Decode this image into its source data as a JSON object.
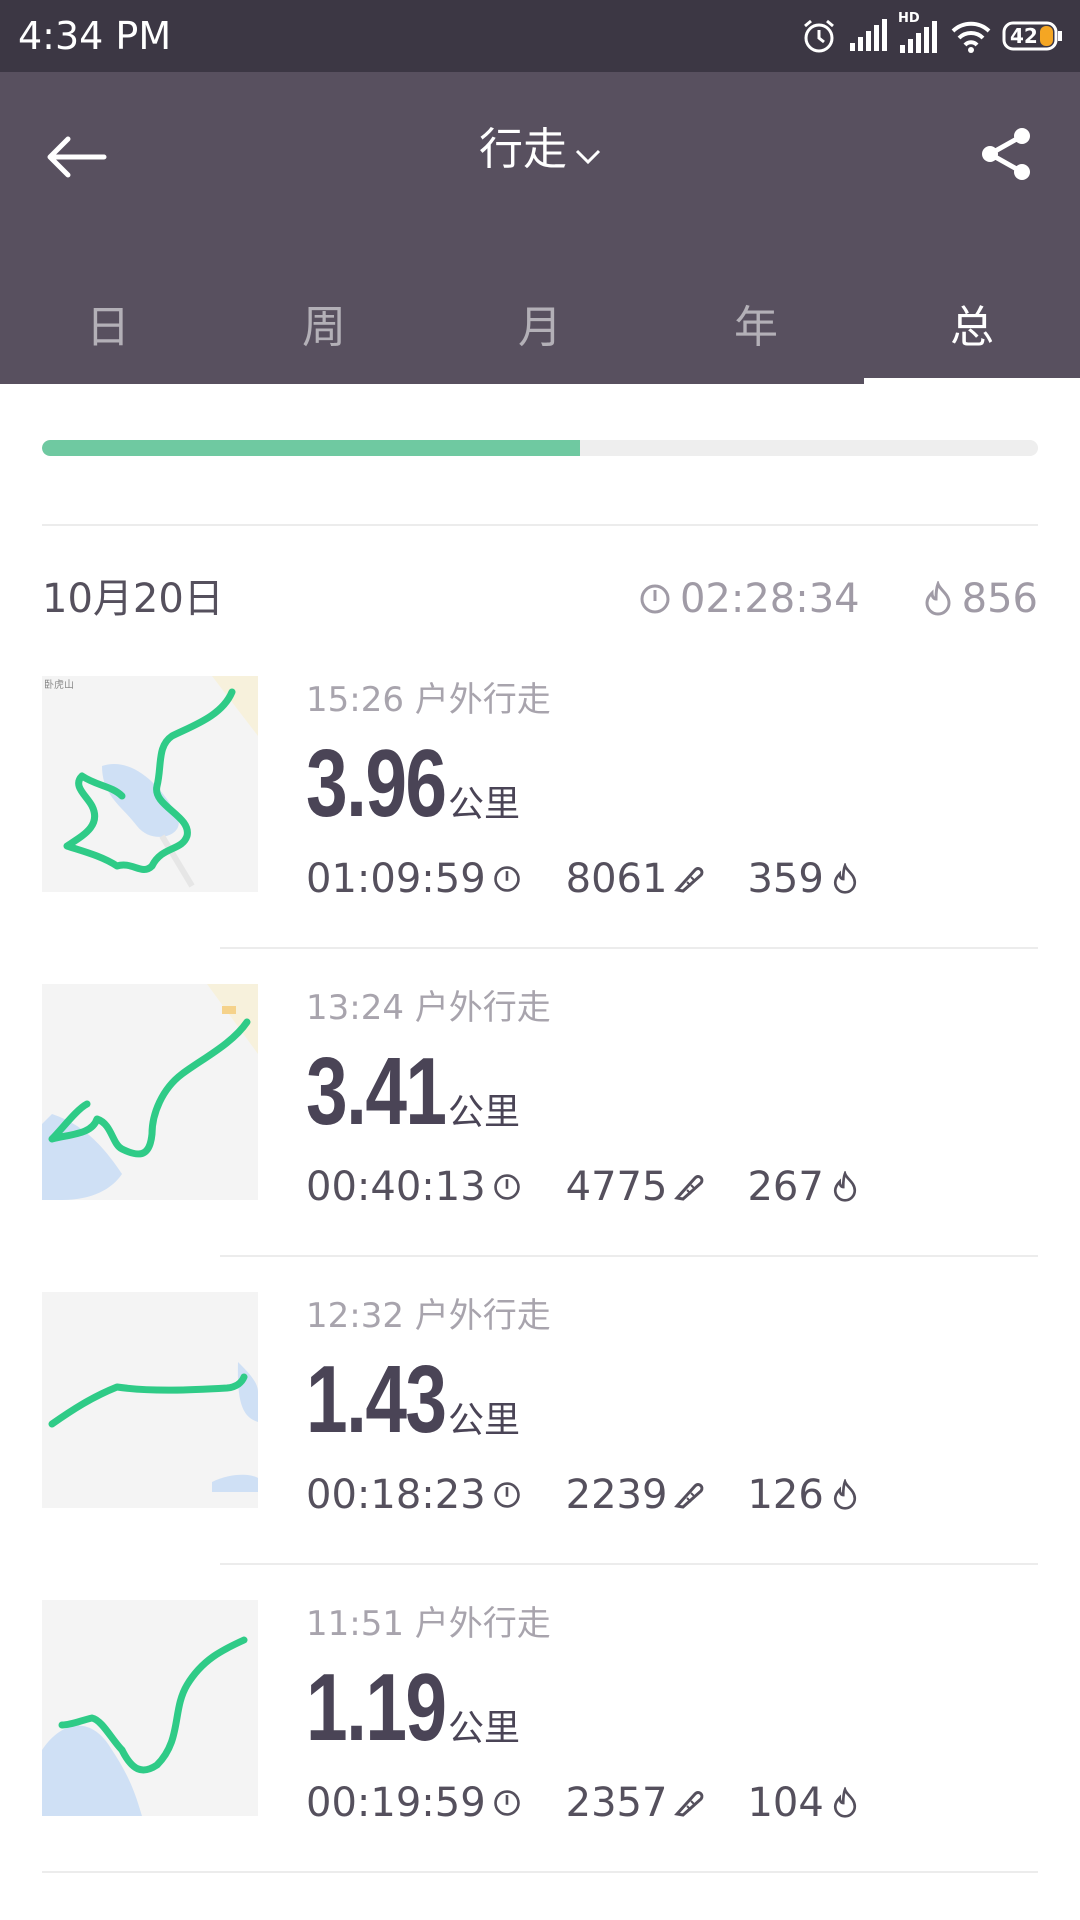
{
  "status_bar": {
    "time": "4:34 PM",
    "battery": "42",
    "hd_label": "HD"
  },
  "header": {
    "title": "行走",
    "tabs": [
      {
        "label": "日",
        "active": false
      },
      {
        "label": "周",
        "active": false
      },
      {
        "label": "月",
        "active": false
      },
      {
        "label": "年",
        "active": false
      },
      {
        "label": "总",
        "active": true
      }
    ]
  },
  "progress": {
    "fraction": 0.54,
    "fill_color": "#6fc9a1"
  },
  "day": {
    "date": "10月20日",
    "total_duration": "02:28:34",
    "total_calories": "856"
  },
  "map_labels": {
    "landmark": "卧虎山"
  },
  "workouts": [
    {
      "time_type": "15:26 户外行走",
      "distance": "3.96",
      "unit": "公里",
      "duration": "01:09:59",
      "steps": "8061",
      "calories": "359"
    },
    {
      "time_type": "13:24 户外行走",
      "distance": "3.41",
      "unit": "公里",
      "duration": "00:40:13",
      "steps": "4775",
      "calories": "267"
    },
    {
      "time_type": "12:32 户外行走",
      "distance": "1.43",
      "unit": "公里",
      "duration": "00:18:23",
      "steps": "2239",
      "calories": "126"
    },
    {
      "time_type": "11:51 户外行走",
      "distance": "1.19",
      "unit": "公里",
      "duration": "00:19:59",
      "steps": "2357",
      "calories": "104"
    }
  ],
  "colors": {
    "header_bg": "#58505f",
    "statusbar_bg": "#3c3744",
    "route_green": "#2fcb87",
    "water": "#cfe0f5"
  }
}
